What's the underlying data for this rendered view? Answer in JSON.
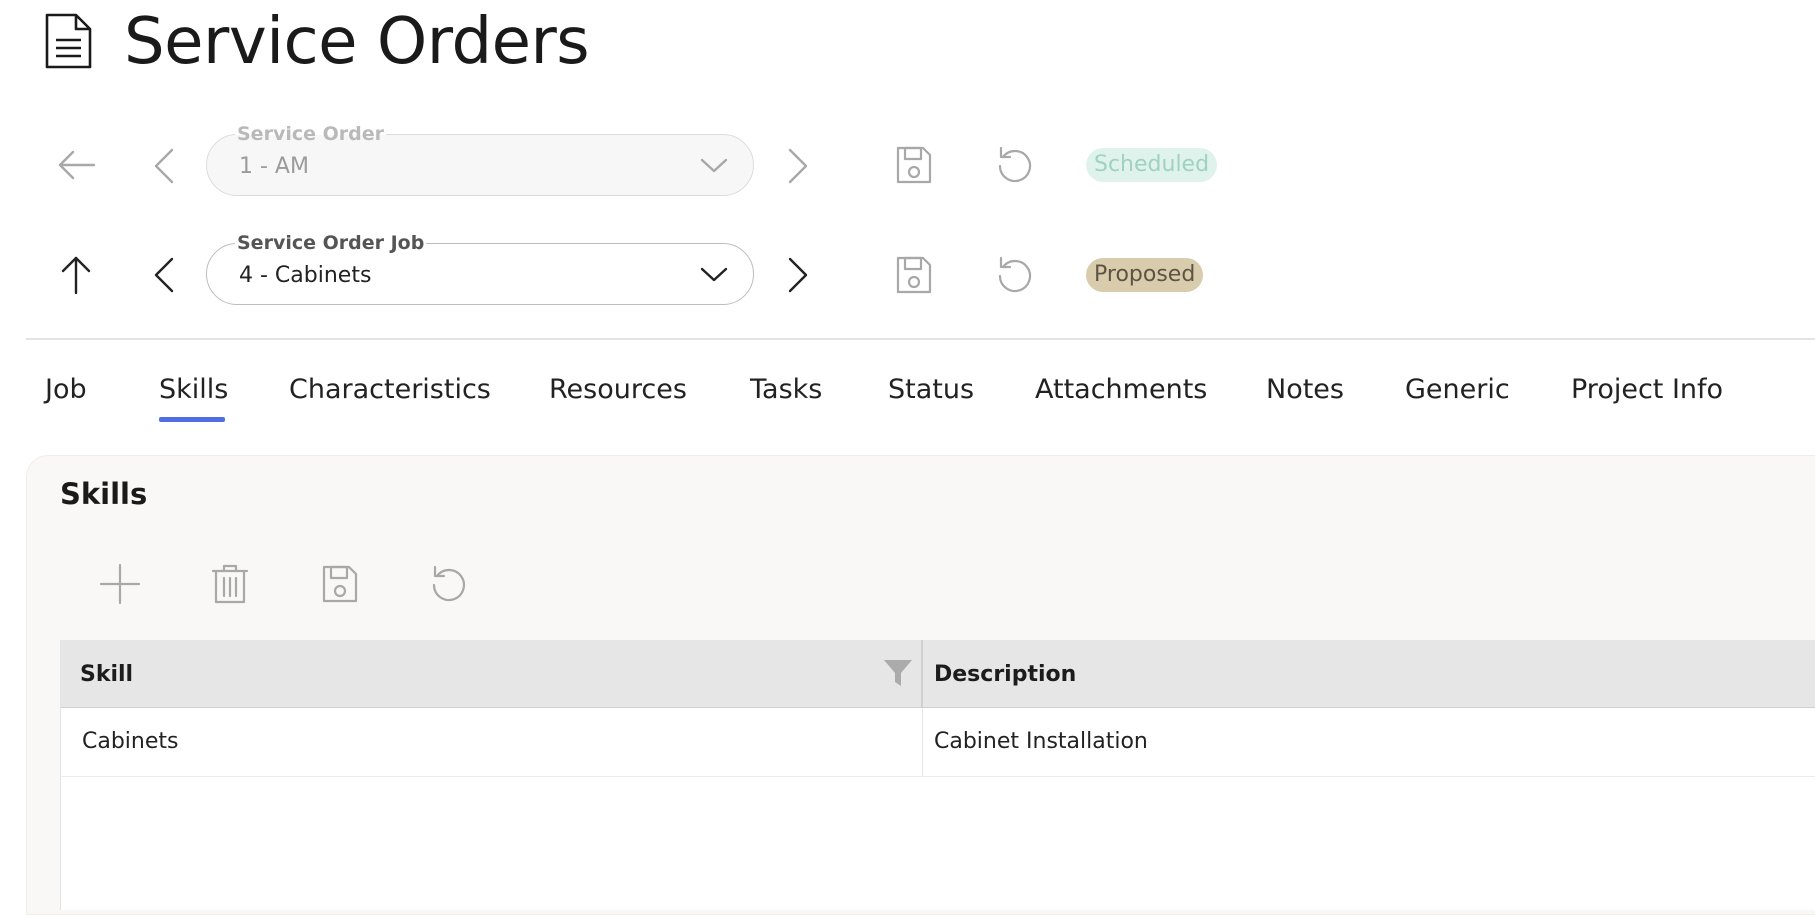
{
  "page": {
    "title": "Service Orders",
    "icon": "document-icon"
  },
  "service_order": {
    "label": "Service Order",
    "value": "1 - AM",
    "status": "Scheduled",
    "status_color": "#dff3ec"
  },
  "service_order_job": {
    "label": "Service Order Job",
    "value": "4 - Cabinets",
    "status": "Proposed",
    "status_color": "#d9ccad"
  },
  "tabs": [
    {
      "label": "Job"
    },
    {
      "label": "Skills",
      "active": true
    },
    {
      "label": "Characteristics"
    },
    {
      "label": "Resources"
    },
    {
      "label": "Tasks"
    },
    {
      "label": "Status"
    },
    {
      "label": "Attachments"
    },
    {
      "label": "Notes"
    },
    {
      "label": "Generic"
    },
    {
      "label": "Project Info"
    }
  ],
  "accent_color": "#4f6ee6",
  "skills_panel": {
    "title": "Skills",
    "toolbar_icons": [
      "plus-icon",
      "trash-icon",
      "save-icon",
      "undo-icon"
    ],
    "grid": {
      "columns": [
        {
          "label": "Skill"
        },
        {
          "label": "Description"
        }
      ],
      "rows": [
        {
          "skill": "Cabinets",
          "description": "Cabinet Installation"
        }
      ]
    }
  }
}
